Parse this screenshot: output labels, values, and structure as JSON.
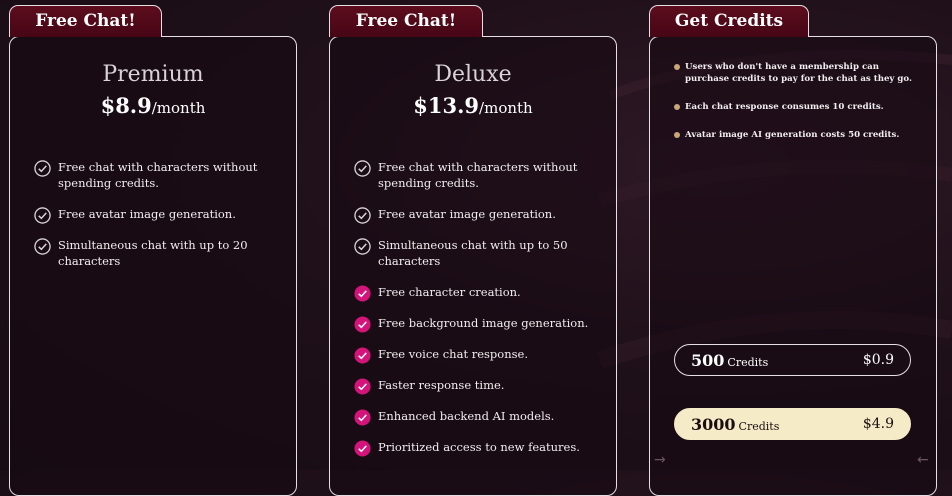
{
  "colors": {
    "tab_background": "#4f0a19",
    "card_border": "#e6dfe3",
    "check_premium": "#ffffff",
    "check_deluxe_extra": "#d4147a",
    "note_dot": "#c8a779",
    "selected_option_bg": "#f6ebc7",
    "page_background": "#1f1019"
  },
  "plans": [
    {
      "tab_label": "Free Chat!",
      "name": "Premium",
      "price": "$8.9",
      "period": "/month",
      "features": [
        {
          "text": "Free chat with characters without spending credits.",
          "icon": "check-circle-white-icon"
        },
        {
          "text": "Free avatar image generation.",
          "icon": "check-circle-white-icon"
        },
        {
          "text": "Simultaneous chat with up to 20 characters",
          "icon": "check-circle-white-icon"
        }
      ]
    },
    {
      "tab_label": "Free Chat!",
      "name": "Deluxe",
      "price": "$13.9",
      "period": "/month",
      "features": [
        {
          "text": "Free chat with characters without spending credits.",
          "icon": "check-circle-white-icon"
        },
        {
          "text": "Free avatar image generation.",
          "icon": "check-circle-white-icon"
        },
        {
          "text": "Simultaneous chat with up to 50 characters",
          "icon": "check-circle-white-icon"
        },
        {
          "text": "Free character creation.",
          "icon": "check-circle-pink-icon"
        },
        {
          "text": "Free background image generation.",
          "icon": "check-circle-pink-icon"
        },
        {
          "text": "Free voice chat response.",
          "icon": "check-circle-pink-icon"
        },
        {
          "text": "Faster response time.",
          "icon": "check-circle-pink-icon"
        },
        {
          "text": "Enhanced backend AI models.",
          "icon": "check-circle-pink-icon"
        },
        {
          "text": "Prioritized access to new features.",
          "icon": "check-circle-pink-icon"
        }
      ]
    }
  ],
  "credits": {
    "tab_label": "Get Credits",
    "notes": [
      "Users who don't have a membership can purchase credits to pay for the chat as they go.",
      "Each chat response consumes 10 credits.",
      "Avatar image AI generation costs 50 credits."
    ],
    "options": [
      {
        "quantity": "500",
        "unit": "Credits",
        "price": "$0.9",
        "selected": false
      },
      {
        "quantity": "3000",
        "unit": "Credits",
        "price": "$4.9",
        "selected": true
      }
    ],
    "arrow_left_icon": "arrow-right-icon",
    "arrow_right_icon": "arrow-left-icon"
  }
}
